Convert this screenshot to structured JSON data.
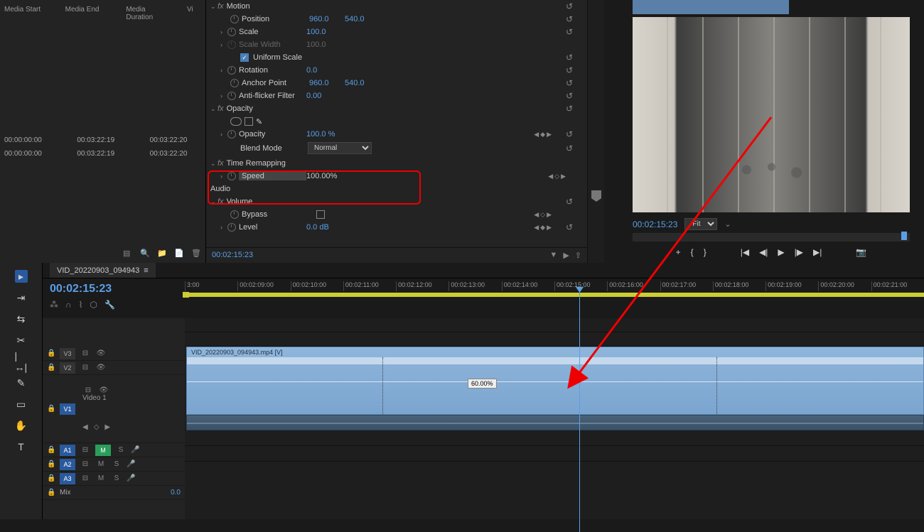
{
  "project": {
    "columns": [
      "Media Start",
      "Media End",
      "Media Duration",
      "Vi"
    ],
    "rows": [
      [
        "00:00:00:00",
        "00:03:22:19",
        "00:03:22:20",
        ""
      ],
      [
        "00:00:00:00",
        "00:03:22:19",
        "00:03:22:20",
        ""
      ]
    ]
  },
  "effects": {
    "motion": {
      "title": "Motion",
      "position": {
        "label": "Position",
        "x": "960.0",
        "y": "540.0"
      },
      "scale": {
        "label": "Scale",
        "v": "100.0"
      },
      "scale_width": {
        "label": "Scale Width",
        "v": "100.0"
      },
      "uniform": "Uniform Scale",
      "rotation": {
        "label": "Rotation",
        "v": "0.0"
      },
      "anchor": {
        "label": "Anchor Point",
        "x": "960.0",
        "y": "540.0"
      },
      "antiflicker": {
        "label": "Anti-flicker Filter",
        "v": "0.00"
      }
    },
    "opacity": {
      "title": "Opacity",
      "opacity": {
        "label": "Opacity",
        "v": "100.0 %"
      },
      "blend": {
        "label": "Blend Mode",
        "v": "Normal"
      }
    },
    "time_remap": {
      "title": "Time Remapping",
      "speed": {
        "label": "Speed",
        "v": "100.00%"
      }
    },
    "audio": {
      "title": "Audio",
      "volume": {
        "label": "Volume"
      },
      "bypass": {
        "label": "Bypass"
      },
      "level": {
        "label": "Level",
        "v": "0.0 dB"
      }
    },
    "footer_tc": "00:02:15:23"
  },
  "program": {
    "tc": "00:02:15:23",
    "fit": "Fit"
  },
  "timeline": {
    "tab": "VID_20220903_094943",
    "tc": "00:02:15:23",
    "ruler": [
      "3:00",
      "00:02:09:00",
      "00:02:10:00",
      "00:02:11:00",
      "00:02:12:00",
      "00:02:13:00",
      "00:02:14:00",
      "00:02:15:00",
      "00:02:16:00",
      "00:02:17:00",
      "00:02:18:00",
      "00:02:19:00",
      "00:02:20:00",
      "00:02:21:00"
    ],
    "tracks": {
      "v3": "V3",
      "v2": "V2",
      "v1": "V1",
      "v1_label": "Video 1",
      "a1": "A1",
      "a2": "A2",
      "a3": "A3",
      "mix": "Mix",
      "mix_v": "0.0",
      "m": "M",
      "s": "S"
    },
    "clip_name": "VID_20220903_094943.mp4 [V]",
    "speed_tip": "60.00%"
  }
}
